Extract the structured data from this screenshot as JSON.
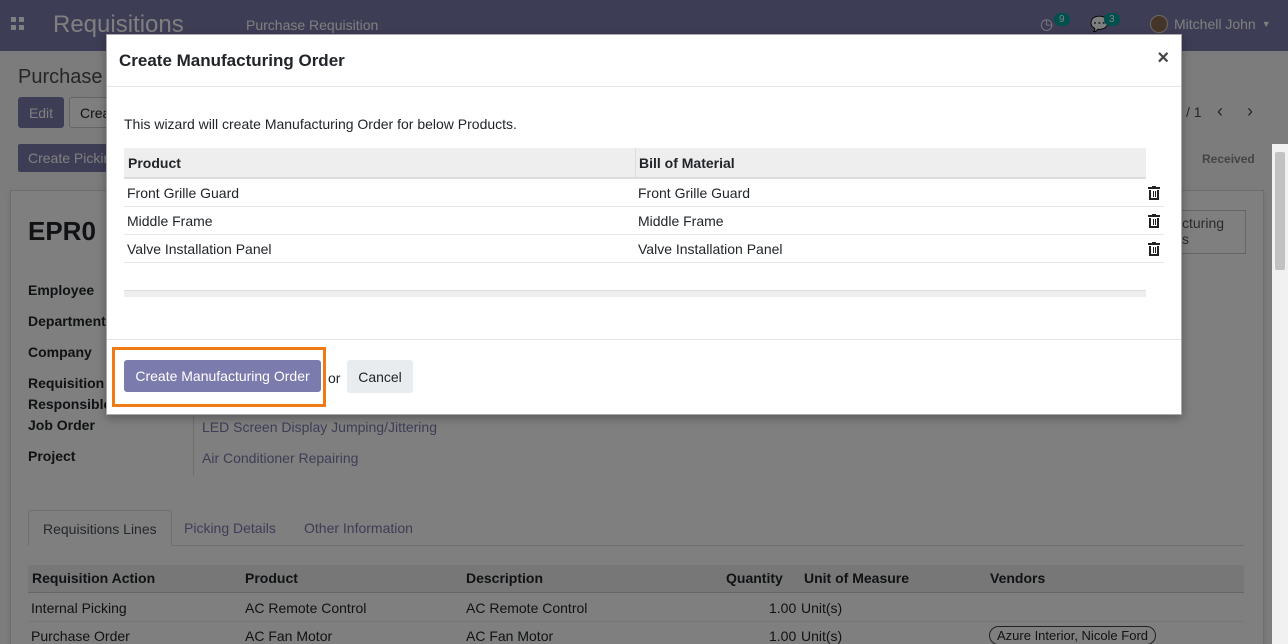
{
  "navbar": {
    "app_name": "Requisitions",
    "menu_item": "Purchase Requisition",
    "activity_count": "9",
    "messages_count": "3",
    "user_name": "Mitchell John"
  },
  "control_panel": {
    "breadcrumb": "Purchase",
    "edit_label": "Edit",
    "create_label": "Crea",
    "pager": "/ 1"
  },
  "statusbar": {
    "create_picking_label": "Create Picking",
    "received_label": "Received"
  },
  "form": {
    "record_name": "EPR0",
    "smart_button_label": "cturing\ns",
    "fields": {
      "employee": "Employee",
      "department": "Department",
      "company": "Company",
      "requisition_responsible_line1": "Requisition",
      "requisition_responsible_line2": "Responsible",
      "job_order_label": "Job Order",
      "job_order_value": "LED Screen Display Jumping/Jittering",
      "project_label": "Project",
      "project_value": "Air Conditioner Repairing"
    },
    "tabs": [
      "Requisitions Lines",
      "Picking Details",
      "Other Information"
    ],
    "lines": {
      "headers": [
        "Requisition Action",
        "Product",
        "Description",
        "Quantity",
        "Unit of Measure",
        "Vendors"
      ],
      "rows": [
        {
          "action": "Internal Picking",
          "product": "AC Remote Control",
          "description": "AC Remote Control",
          "qty": "1.00",
          "uom": "Unit(s)",
          "vendors": ""
        },
        {
          "action": "Purchase Order",
          "product": "AC Fan Motor",
          "description": "AC Fan Motor",
          "qty": "1.00",
          "uom": "Unit(s)",
          "vendors": "Azure Interior, Nicole Ford"
        }
      ]
    }
  },
  "modal": {
    "title": "Create Manufacturing Order",
    "close_symbol": "×",
    "intro": "This wizard will create Manufacturing Order for below Products.",
    "columns": {
      "product": "Product",
      "bom": "Bill of Material"
    },
    "rows": [
      {
        "product": "Front Grille Guard",
        "bom": "Front Grille Guard"
      },
      {
        "product": "Middle Frame",
        "bom": "Middle Frame"
      },
      {
        "product": "Valve Installation Panel",
        "bom": "Valve Installation Panel"
      }
    ],
    "create_button": "Create Manufacturing Order",
    "or_text": "or",
    "cancel_button": "Cancel"
  },
  "colors": {
    "brand": "#7c7bad",
    "highlight": "#f07b14",
    "badge": "#00a09d"
  }
}
